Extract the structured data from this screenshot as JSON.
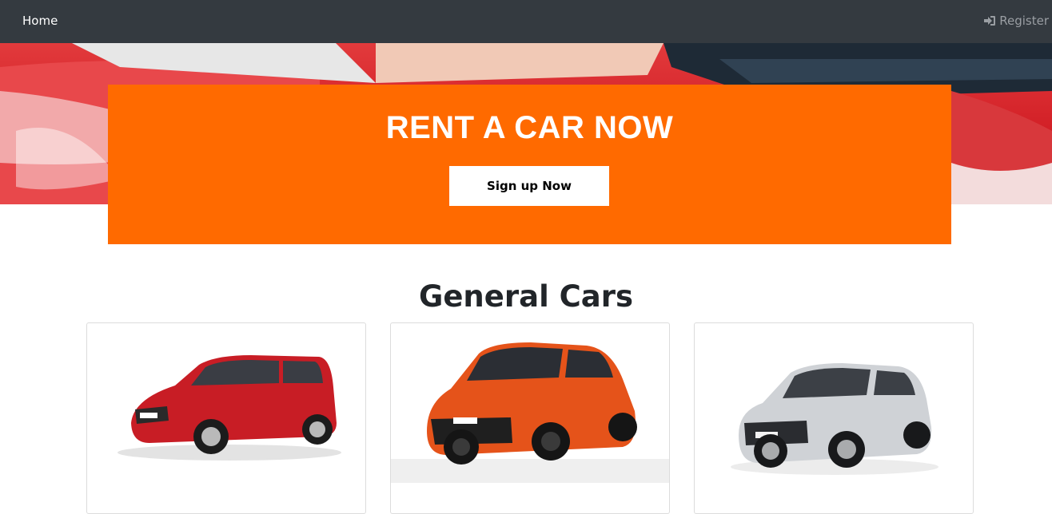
{
  "navbar": {
    "home_label": "Home",
    "register_label": "Register",
    "register_icon": "sign-in-icon"
  },
  "banner": {
    "title": "RENT A CAR NOW",
    "button_label": "Sign up Now"
  },
  "section": {
    "title": "General Cars"
  },
  "cars": [
    {
      "image": "red-hatchback-car",
      "color": "#c81d25"
    },
    {
      "image": "orange-hatchback-car",
      "color": "#e5531a"
    },
    {
      "image": "silver-hatchback-car",
      "color": "#cfd2d6"
    }
  ],
  "colors": {
    "navbar": "#343a40",
    "banner": "#ff6a00",
    "text": "#212529"
  }
}
